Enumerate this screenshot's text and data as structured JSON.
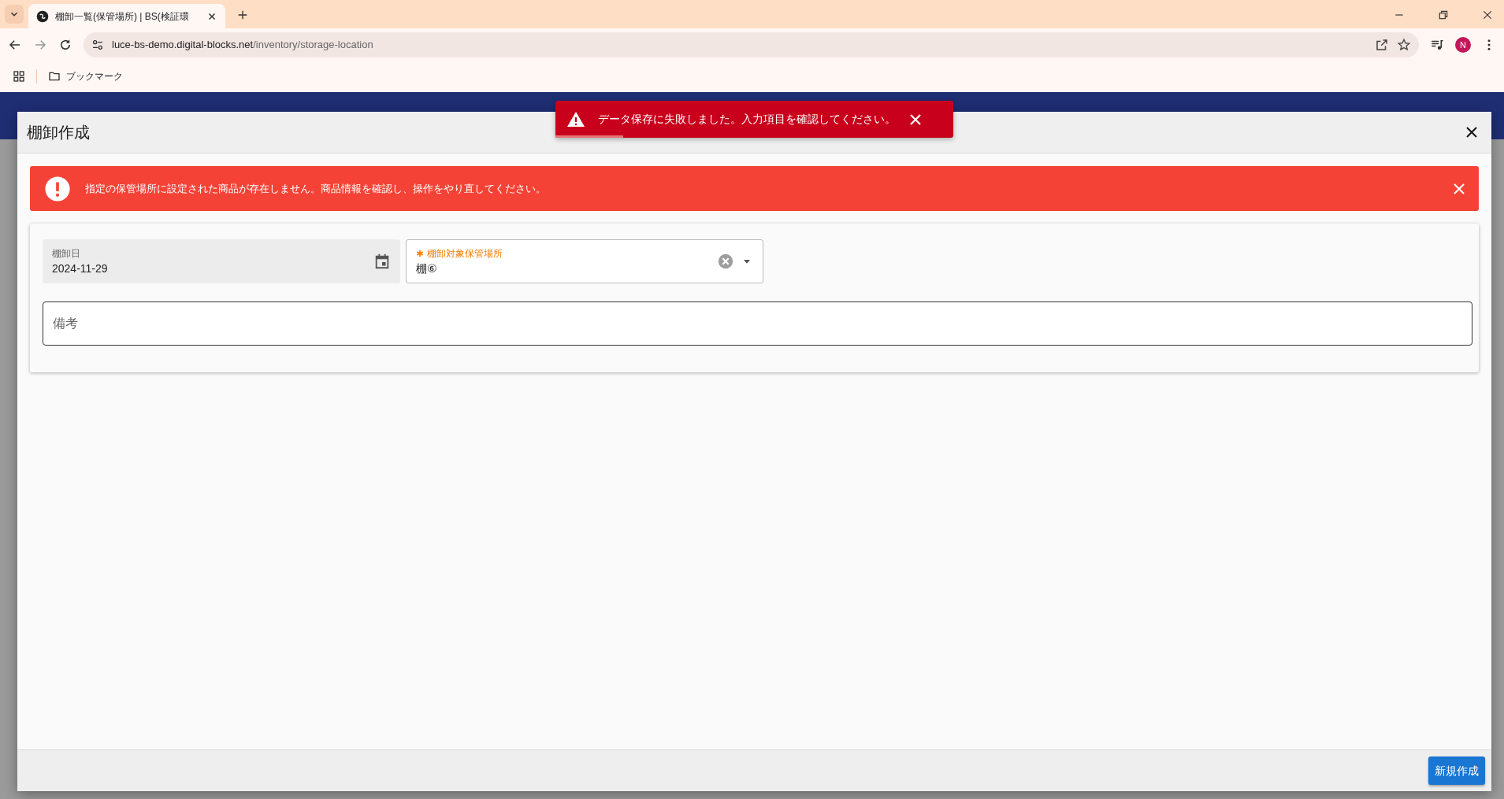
{
  "browser": {
    "tabs": [
      {
        "title": "棚卸一覧(保管場所) | BS(検証環",
        "selected": true
      }
    ],
    "url_host": "luce-bs-demo.digital-blocks.net",
    "url_path": "/inventory/storage-location",
    "bookmarks_label": "ブックマーク",
    "profile_initial": "N"
  },
  "toast": {
    "message": "データ保存に失敗しました。入力項目を確認してください。",
    "level": 0.17
  },
  "dialog": {
    "title": "棚卸作成",
    "alert": {
      "message": "指定の保管場所に設定された商品が存在しません。商品情報を確認し、操作をやり直してください。"
    },
    "fields": [
      {
        "kind": "date",
        "label": "棚卸日",
        "value": "2024-11-29",
        "required": false
      },
      {
        "kind": "select",
        "label": "棚卸対象保管場所",
        "value": "棚⑥",
        "required": true
      }
    ],
    "remarks": {
      "placeholder": "備考"
    },
    "submit_label": "新規作成"
  }
}
